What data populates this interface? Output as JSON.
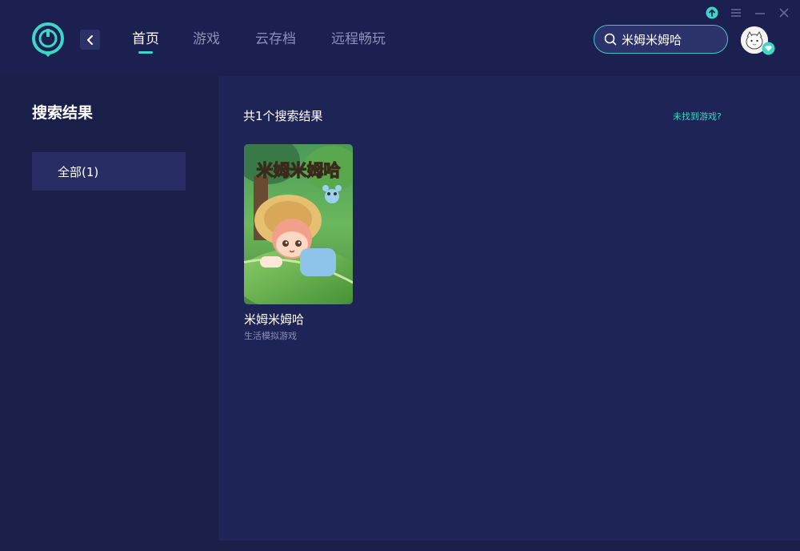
{
  "nav": {
    "items": [
      {
        "label": "首页",
        "active": true
      },
      {
        "label": "游戏",
        "active": false
      },
      {
        "label": "云存档",
        "active": false
      },
      {
        "label": "远程畅玩",
        "active": false
      }
    ]
  },
  "search": {
    "value": "米姆米姆哈",
    "icon": "search-icon"
  },
  "window_controls": [
    "upload-icon",
    "menu-icon",
    "minimize-icon",
    "close-icon"
  ],
  "sidebar": {
    "title": "搜索结果",
    "filters": [
      {
        "label": "全部(1)",
        "selected": true
      }
    ]
  },
  "results": {
    "count_text": "共1个搜索结果",
    "not_found_link": "未找到游戏?",
    "games": [
      {
        "name": "米姆米姆哈",
        "genre": "生活模拟游戏",
        "cover_title": "米姆米姆哈"
      }
    ]
  },
  "colors": {
    "accent": "#3fd6c8",
    "background": "#1a1f4a",
    "panel": "#1f2456",
    "selected": "#272d62"
  }
}
